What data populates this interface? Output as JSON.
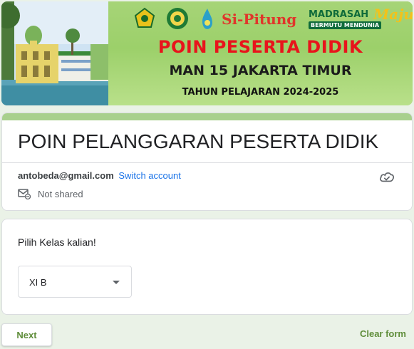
{
  "banner": {
    "logo_situng": "Si-Pitung",
    "logo_madrasah": "MADRASAH",
    "logo_maju": "Maju",
    "logo_bermutu": "BERMUTU MENDUNIA",
    "line1": "POIN PESERTA DIDIK",
    "line2": "MAN 15 JAKARTA TIMUR",
    "line3": "TAHUN PELAJARAN 2024-2025"
  },
  "form": {
    "title": "POIN PELANGGARAN PESERTA DIDIK",
    "account_email": "antobeda@gmail.com",
    "switch_account": "Switch account",
    "not_shared": "Not shared",
    "icons": {
      "cloud": "cloud-saved-icon",
      "shared": "not-shared-mail-icon"
    }
  },
  "question": {
    "label": "Pilih Kelas kalian!",
    "selected": "XI B"
  },
  "actions": {
    "next": "Next",
    "clear": "Clear form"
  },
  "colors": {
    "accent": "#a8d08d",
    "button_text": "#5f8d3a",
    "link": "#1a73e8",
    "background": "#eaf2e7"
  }
}
